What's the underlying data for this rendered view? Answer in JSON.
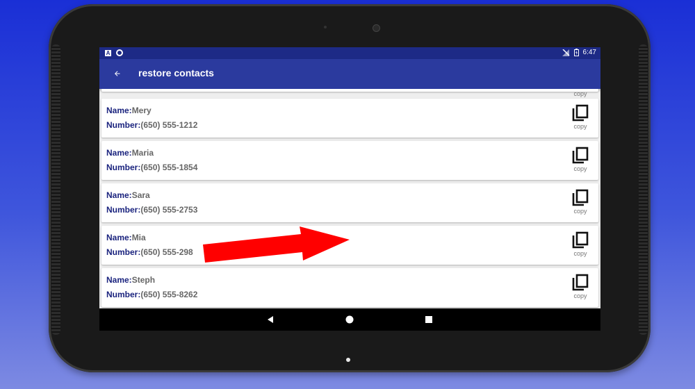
{
  "status_bar": {
    "time": "6:47"
  },
  "app_bar": {
    "title": "restore contacts"
  },
  "labels": {
    "name": "Name:",
    "number": "Number:",
    "copy": "copy"
  },
  "contacts": [
    {
      "name": "Mery",
      "number": "(650) 555-1212"
    },
    {
      "name": "Maria",
      "number": "(650) 555-1854"
    },
    {
      "name": "Sara",
      "number": "(650) 555-2753"
    },
    {
      "name": "Mia",
      "number": "(650) 555-298"
    },
    {
      "name": "Steph",
      "number": "(650) 555-8262"
    }
  ],
  "partial_card": {
    "copy_label": "copy"
  },
  "colors": {
    "status_bar": "#1d2a86",
    "app_bar": "#2b3a9e",
    "label_text": "#1a237e",
    "value_text": "#666666",
    "annotation_arrow": "#ff0000"
  }
}
